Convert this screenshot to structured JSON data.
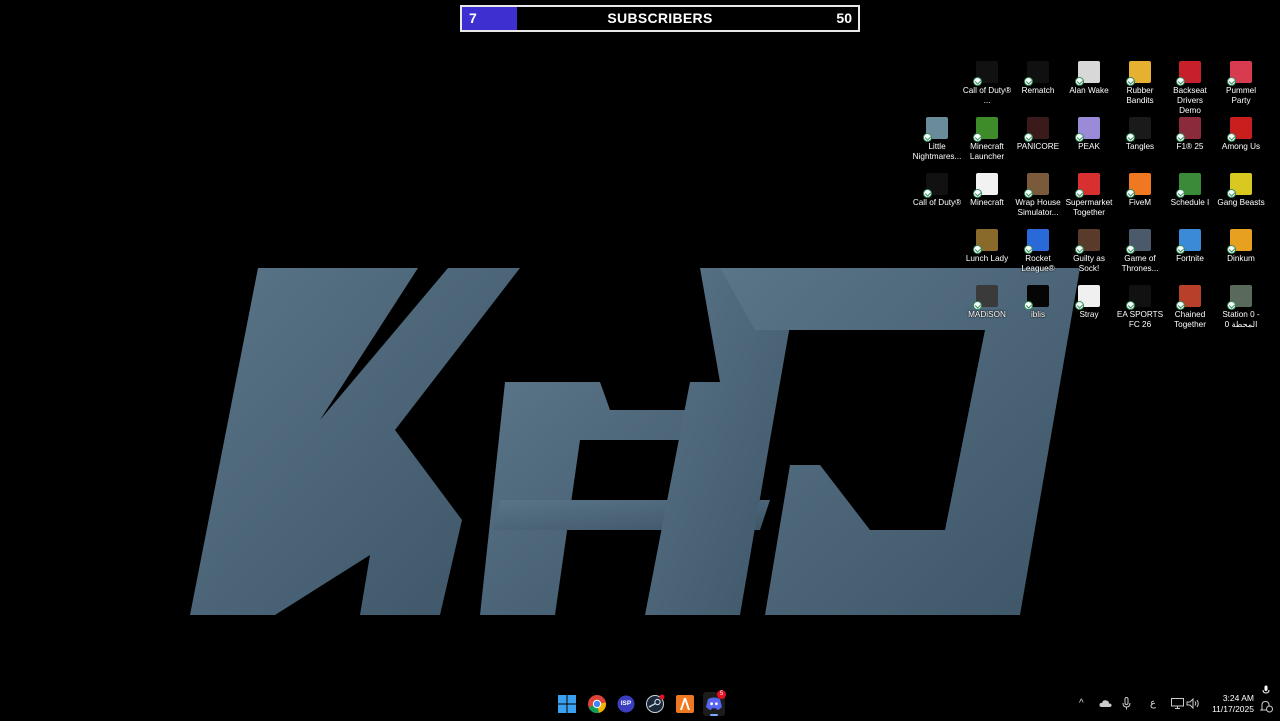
{
  "overlay": {
    "current": "7",
    "title": "SUBSCRIBERS",
    "goal": "50",
    "progress_fraction": 0.14,
    "fill_color": "#3d2fd0"
  },
  "wallpaper": {
    "text": "KHD",
    "color": "#4b6478"
  },
  "desktop_icons": [
    {
      "label": "Call of Duty® ...",
      "icon": "call-of-duty-icon",
      "color": "#111111"
    },
    {
      "label": "Rematch",
      "icon": "rematch-icon",
      "color": "#101010"
    },
    {
      "label": "Alan Wake",
      "icon": "alan-wake-icon",
      "color": "#d8d8d8"
    },
    {
      "label": "Rubber Bandits",
      "icon": "rubber-bandits-icon",
      "color": "#e6b030"
    },
    {
      "label": "Backseat Drivers Demo",
      "icon": "backseat-drivers-icon",
      "color": "#c8202a"
    },
    {
      "label": "Pummel Party",
      "icon": "pummel-party-icon",
      "color": "#d83a50"
    },
    {
      "label": "Little Nightmares...",
      "icon": "little-nightmares-icon",
      "color": "#6a8c9a"
    },
    {
      "label": "Minecraft Launcher",
      "icon": "minecraft-launcher-icon",
      "color": "#3e8b2a"
    },
    {
      "label": "PANICORE",
      "icon": "panicore-icon",
      "color": "#3a1a1a"
    },
    {
      "label": "PEAK",
      "icon": "peak-icon",
      "color": "#9a8ad8"
    },
    {
      "label": "Tangles",
      "icon": "tangles-icon",
      "color": "#1a1a1a"
    },
    {
      "label": "F1® 25",
      "icon": "f1-25-icon",
      "color": "#8a2a3a"
    },
    {
      "label": "Among Us",
      "icon": "among-us-icon",
      "color": "#c81e1e"
    },
    {
      "label": "Call of Duty®",
      "icon": "call-of-duty-icon",
      "color": "#111111"
    },
    {
      "label": "Minecraft",
      "icon": "file-icon",
      "color": "#f2f2f2"
    },
    {
      "label": "Wrap House Simulator...",
      "icon": "wrap-house-simulator-icon",
      "color": "#7a5a3a"
    },
    {
      "label": "Supermarket Together",
      "icon": "supermarket-together-icon",
      "color": "#d83030"
    },
    {
      "label": "FiveM",
      "icon": "fivem-icon",
      "color": "#f07820"
    },
    {
      "label": "Schedule I",
      "icon": "schedule-i-icon",
      "color": "#3a8a3a"
    },
    {
      "label": "Gang Beasts",
      "icon": "gang-beasts-icon",
      "color": "#d8c820"
    },
    {
      "label": "Lunch Lady",
      "icon": "lunch-lady-icon",
      "color": "#8a6a2a"
    },
    {
      "label": "Rocket League®",
      "icon": "rocket-league-icon",
      "color": "#2a6ad8"
    },
    {
      "label": "Guilty as Sock!",
      "icon": "guilty-as-sock-icon",
      "color": "#5a3a2a"
    },
    {
      "label": "Game of Thrones...",
      "icon": "game-of-thrones-icon",
      "color": "#4a5a6a"
    },
    {
      "label": "Fortnite",
      "icon": "fortnite-icon",
      "color": "#3a8ad8"
    },
    {
      "label": "Dinkum",
      "icon": "dinkum-icon",
      "color": "#e8a020"
    },
    {
      "label": "MADiSON",
      "icon": "madison-icon",
      "color": "#3a3a3a"
    },
    {
      "label": "iblis",
      "icon": "iblis-icon",
      "color": "#050505"
    },
    {
      "label": "Stray",
      "icon": "stray-icon",
      "color": "#f0f0f0"
    },
    {
      "label": "EA SPORTS FC 26",
      "icon": "ea-sports-fc-icon",
      "color": "#111111"
    },
    {
      "label": "Chained Together",
      "icon": "chained-together-icon",
      "color": "#b8402a"
    },
    {
      "label": "Station 0 - المحطة 0",
      "icon": "station-0-icon",
      "color": "#5a6a5a"
    }
  ],
  "taskbar": {
    "apps": [
      {
        "name": "start-button",
        "icon": "windows-icon"
      },
      {
        "name": "chrome-button",
        "icon": "chrome-icon"
      },
      {
        "name": "isp-button",
        "icon": "isp-icon",
        "text": "ISP"
      },
      {
        "name": "steam-button",
        "icon": "steam-icon"
      },
      {
        "name": "fivem-taskbar-button",
        "icon": "fivem-icon"
      },
      {
        "name": "discord-button",
        "icon": "discord-icon",
        "badge": "5"
      }
    ],
    "tray": {
      "chevron": "^",
      "language": "ع",
      "time": "3:24 AM",
      "date": "11/17/2025"
    }
  }
}
